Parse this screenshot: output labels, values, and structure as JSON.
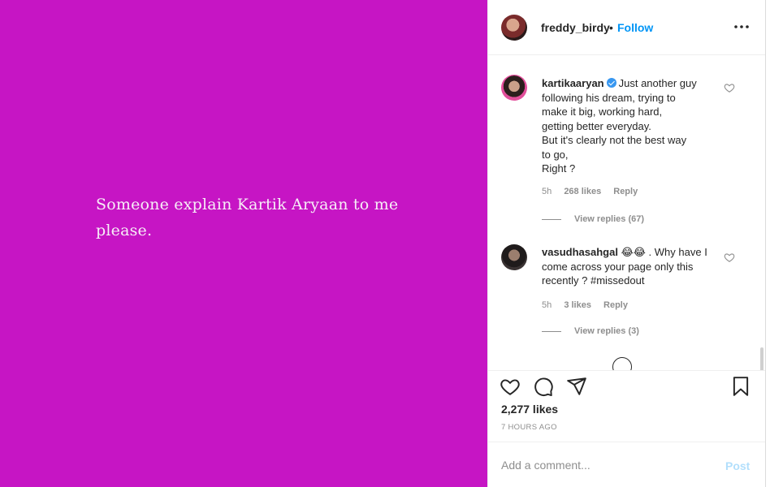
{
  "post": {
    "image_text": "Someone explain Kartik Aryaan to me please.",
    "background_color": "#c615c4"
  },
  "header": {
    "username": "freddy_birdy",
    "separator": "•",
    "follow_label": "Follow",
    "more_icon": "more-horizontal-icon"
  },
  "comments": [
    {
      "username": "kartikaaryan",
      "verified": true,
      "text": "Just another guy\nfollowing his dream, trying to\nmake it big, working hard,\ngetting better everyday.\nBut it's clearly not the best way\nto go,\nRight ?",
      "time": "5h",
      "likes": "268 likes",
      "reply_label": "Reply",
      "view_replies": "View replies (67)"
    },
    {
      "username": "vasudhasahgal",
      "verified": false,
      "text": "😂😂 . Why have I\ncome across your page only this\nrecently ? #missedout",
      "time": "5h",
      "likes": "3 likes",
      "reply_label": "Reply",
      "view_replies": "View replies (3)"
    }
  ],
  "actions": {
    "like_icon": "heart-icon",
    "comment_icon": "comment-icon",
    "share_icon": "share-icon",
    "save_icon": "bookmark-icon"
  },
  "stats": {
    "likes": "2,277 likes",
    "time_ago": "7 HOURS AGO"
  },
  "comment_box": {
    "placeholder": "Add a comment...",
    "post_label": "Post"
  }
}
